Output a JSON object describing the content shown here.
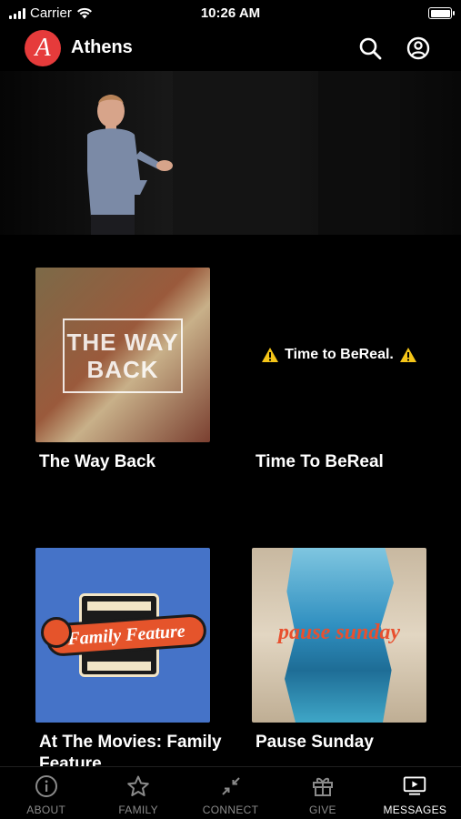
{
  "status_bar": {
    "carrier": "Carrier",
    "time": "10:26 AM"
  },
  "header": {
    "logo_letter": "A",
    "title": "Athens",
    "search_icon": "search-icon",
    "account_icon": "account-icon"
  },
  "messages": [
    {
      "title": "The Way Back",
      "art_line1": "THE WAY",
      "art_line2": "BACK"
    },
    {
      "title": "Time To BeReal",
      "art_text": "Time to BeReal."
    },
    {
      "title": "At The Movies: Family Feature",
      "art_text": "Family Feature"
    },
    {
      "title": "Pause Sunday",
      "art_text": "pause sunday"
    }
  ],
  "tabs": [
    {
      "label": "ABOUT",
      "icon": "info-icon",
      "active": false
    },
    {
      "label": "FAMILY",
      "icon": "star-icon",
      "active": false
    },
    {
      "label": "CONNECT",
      "icon": "collapse-arrows-icon",
      "active": false
    },
    {
      "label": "GIVE",
      "icon": "gift-icon",
      "active": false
    },
    {
      "label": "MESSAGES",
      "icon": "tv-play-icon",
      "active": true
    }
  ],
  "colors": {
    "accent": "#e63b3b",
    "active_tab": "#ffffff",
    "inactive_tab": "#8a8a8a"
  }
}
